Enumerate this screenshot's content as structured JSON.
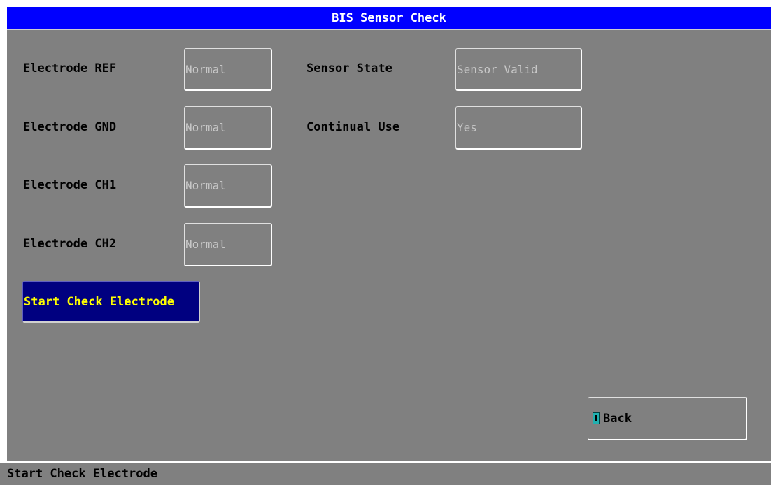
{
  "window": {
    "title": "BIS Sensor Check"
  },
  "electrodes": [
    {
      "label": "Electrode REF",
      "value": "Normal"
    },
    {
      "label": "Electrode GND",
      "value": "Normal"
    },
    {
      "label": "Electrode CH1",
      "value": "Normal"
    },
    {
      "label": "Electrode CH2",
      "value": "Normal"
    }
  ],
  "sensor": {
    "state_label": "Sensor State",
    "state_value": "Sensor Valid",
    "continual_label": "Continual Use",
    "continual_value": "Yes"
  },
  "actions": {
    "start_check": "Start Check Electrode",
    "back": "Back",
    "back_icon": "exit-door-icon"
  },
  "status": {
    "message": "Start Check Electrode"
  },
  "colors": {
    "title_bar": "#0000ff",
    "panel": "#808080",
    "selected_button": "#000080",
    "selected_text": "#ffff00",
    "field_text": "#c8c8c8"
  }
}
